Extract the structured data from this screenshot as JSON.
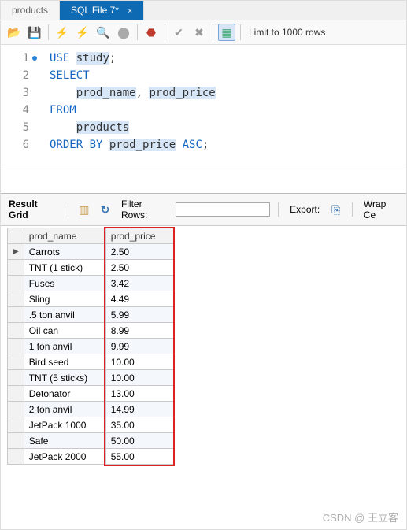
{
  "tabs": [
    {
      "label": "products",
      "active": false
    },
    {
      "label": "SQL File 7*",
      "active": true
    }
  ],
  "toolbar": {
    "limit_label": "Limit to 1000 rows"
  },
  "editor": {
    "lines": [
      {
        "n": "1",
        "modified": true,
        "tokens": [
          [
            "kw",
            "USE"
          ],
          [
            "sp",
            " "
          ],
          [
            "ident hl",
            "study"
          ],
          [
            "punct",
            ";"
          ]
        ]
      },
      {
        "n": "2",
        "tokens": [
          [
            "kw",
            "SELECT"
          ]
        ]
      },
      {
        "n": "3",
        "tokens": [
          [
            "sp",
            "    "
          ],
          [
            "ident hl",
            "prod_name"
          ],
          [
            "punct",
            ","
          ],
          [
            "sp",
            " "
          ],
          [
            "ident hl",
            "prod_price"
          ]
        ]
      },
      {
        "n": "4",
        "tokens": [
          [
            "kw",
            "FROM"
          ]
        ]
      },
      {
        "n": "5",
        "tokens": [
          [
            "sp",
            "    "
          ],
          [
            "ident hl",
            "products"
          ]
        ]
      },
      {
        "n": "6",
        "tokens": [
          [
            "kw",
            "ORDER BY"
          ],
          [
            "sp",
            " "
          ],
          [
            "ident hl",
            "prod_price"
          ],
          [
            "sp",
            " "
          ],
          [
            "kw",
            "ASC"
          ],
          [
            "punct",
            ";"
          ]
        ]
      }
    ]
  },
  "results": {
    "grid_label": "Result Grid",
    "filter_label": "Filter Rows:",
    "filter_value": "",
    "export_label": "Export:",
    "wrap_label": "Wrap Ce"
  },
  "chart_data": {
    "type": "table",
    "columns": [
      "prod_name",
      "prod_price"
    ],
    "rows": [
      [
        "Carrots",
        "2.50"
      ],
      [
        "TNT (1 stick)",
        "2.50"
      ],
      [
        "Fuses",
        "3.42"
      ],
      [
        "Sling",
        "4.49"
      ],
      [
        ".5 ton anvil",
        "5.99"
      ],
      [
        "Oil can",
        "8.99"
      ],
      [
        "1 ton anvil",
        "9.99"
      ],
      [
        "Bird seed",
        "10.00"
      ],
      [
        "TNT (5 sticks)",
        "10.00"
      ],
      [
        "Detonator",
        "13.00"
      ],
      [
        "2 ton anvil",
        "14.99"
      ],
      [
        "JetPack 1000",
        "35.00"
      ],
      [
        "Safe",
        "50.00"
      ],
      [
        "JetPack 2000",
        "55.00"
      ]
    ]
  },
  "watermark": "CSDN @ 王立客"
}
